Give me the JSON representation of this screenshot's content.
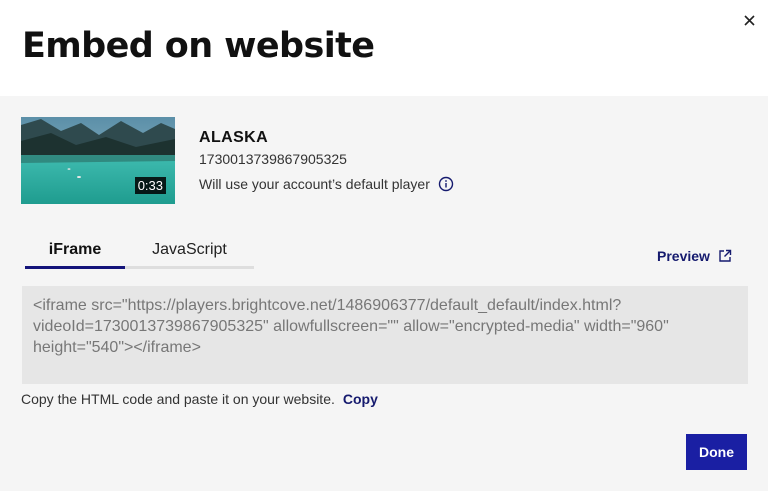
{
  "dialog": {
    "title": "Embed on website",
    "close_icon": "close-icon"
  },
  "video": {
    "name": "ALASKA",
    "id": "1730013739867905325",
    "player_note": "Will use your account’s default player",
    "duration": "0:33",
    "thumbnail": "lake-mountains-thumbnail"
  },
  "tabs": [
    {
      "label": "iFrame",
      "active": true
    },
    {
      "label": "JavaScript",
      "active": false
    }
  ],
  "preview": {
    "label": "Preview",
    "icon": "external-link-icon"
  },
  "embed_code": "<iframe src=\"https://players.brightcove.net/1486906377/default_default/index.html?videoId=1730013739867905325\" allowfullscreen=\"\" allow=\"encrypted-media\" width=\"960\" height=\"540\"></iframe>",
  "hint": {
    "text": "Copy the HTML code and paste it on your website.",
    "copy_label": "Copy"
  },
  "done_label": "Done",
  "colors": {
    "accent": "#1a1fa3",
    "link": "#151a6e",
    "tab_underline": "#14147a",
    "panel_bg": "#f5f5f5",
    "code_bg": "#e6e6e6"
  }
}
